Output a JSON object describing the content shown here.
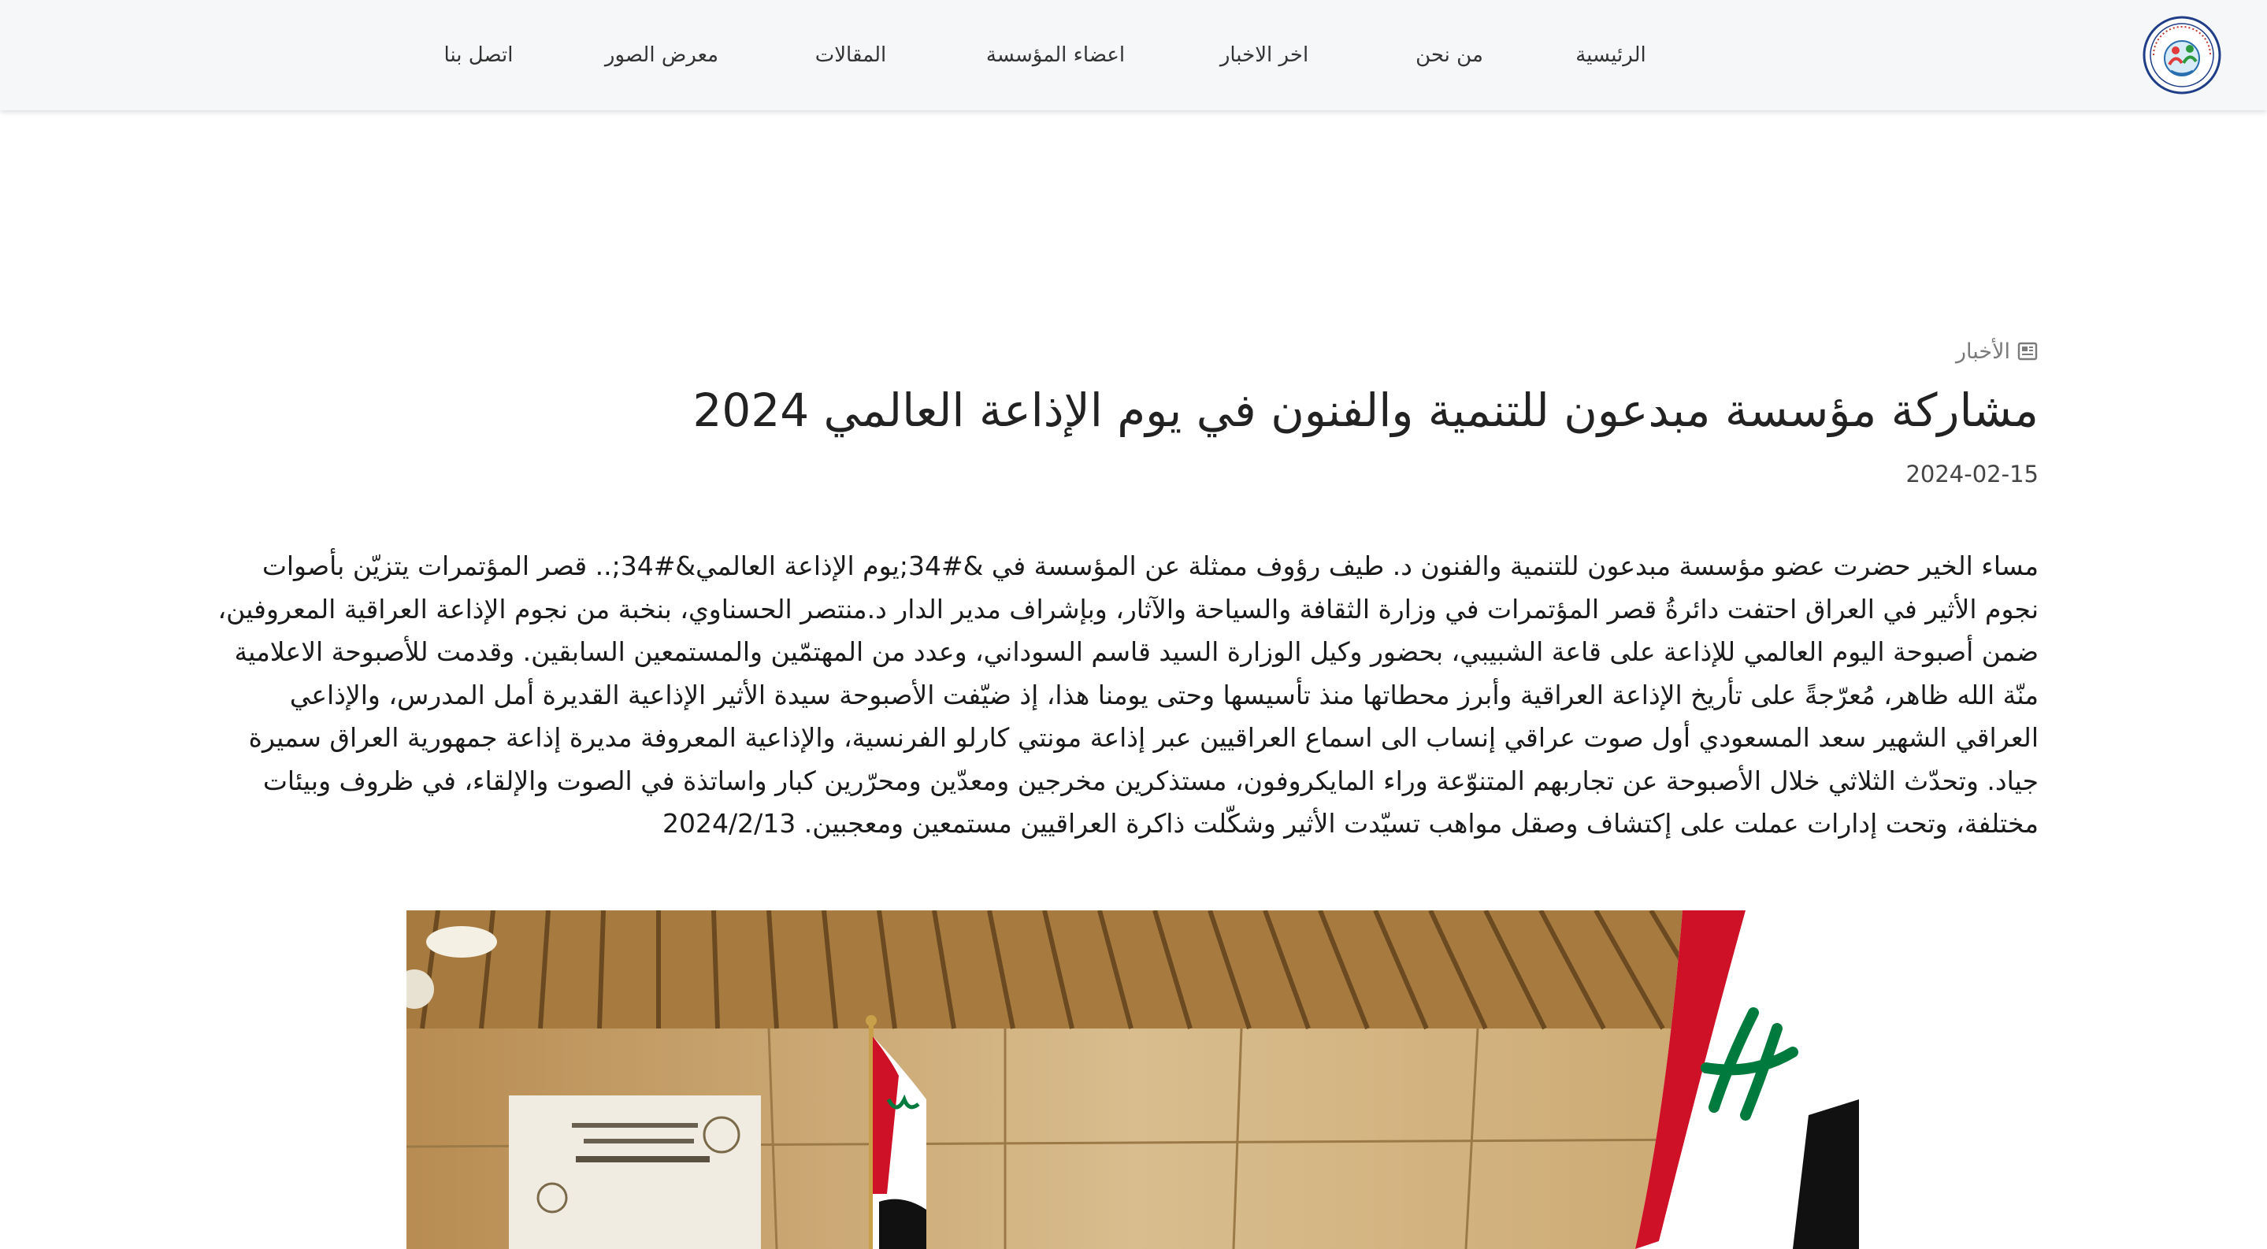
{
  "nav": {
    "items": [
      {
        "label": "الرئيسية"
      },
      {
        "label": "من نحن"
      },
      {
        "label": "اخر الاخبار"
      },
      {
        "label": "اعضاء المؤسسة"
      },
      {
        "label": "المقالات"
      },
      {
        "label": "معرض الصور"
      },
      {
        "label": "اتصل بنا"
      }
    ],
    "logo_icon": "organization-logo"
  },
  "article": {
    "category": "الأخبار",
    "category_icon": "newspaper-icon",
    "title": "مشاركة مؤسسة مبدعون للتنمية والفنون في يوم الإذاعة العالمي 2024",
    "date": "2024-02-15",
    "body": "مساء الخير حضرت عضو مؤسسة مبدعون للتنمية والفنون د. طيف رؤوف ممثلة عن المؤسسة في &#34;يوم الإذاعة العالمي&#34;.. قصر المؤتمرات يتزيّن بأصوات نجوم الأثير في العراق احتفت دائرةُ قصر المؤتمرات في وزارة الثقافة والسياحة والآثار، وبإشراف مدير الدار د.منتصر الحسناوي، بنخبة من نجوم الإذاعة العراقية المعروفين، ضمن أصبوحة اليوم العالمي للإذاعة على قاعة الشبيبي، بحضور وكيل الوزارة السيد قاسم السوداني، وعدد من المهتمّين والمستمعين السابقين. وقدمت للأصبوحة الاعلامية منّة الله ظاهر، مُعرّجةً على تأريخ الإذاعة العراقية وأبرز محطاتها منذ تأسيسها وحتى يومنا هذا، إذ ضيّفت الأصبوحة سيدة الأثير الإذاعية القديرة أمل المدرس، والإذاعي العراقي الشهير سعد المسعودي أول صوت عراقي إنساب الى اسماع العراقيين عبر إذاعة مونتي كارلو الفرنسية، والإذاعية المعروفة مديرة إذاعة جمهورية العراق سميرة جياد. وتحدّث الثلاثي خلال الأصبوحة عن تجاربهم المتنوّعة وراء المايكروفون، مستذكرين مخرجين ومعدّين ومحرّرين كبار واساتذة في الصوت والإلقاء، في ظروف وبيئات مختلفة، وتحت إدارات عملت على إكتشاف وصقل مواهب تسيّدت الأثير وشكّلت ذاكرة العراقيين مستمعين ومعجبين. 2024/2/13",
    "image_subject": "event-photo"
  },
  "colors": {
    "navbar_bg": "#f6f7f8",
    "text": "#222222",
    "muted": "#7a7a7a",
    "flag_red": "#ce1126",
    "flag_green": "#007a3d"
  }
}
